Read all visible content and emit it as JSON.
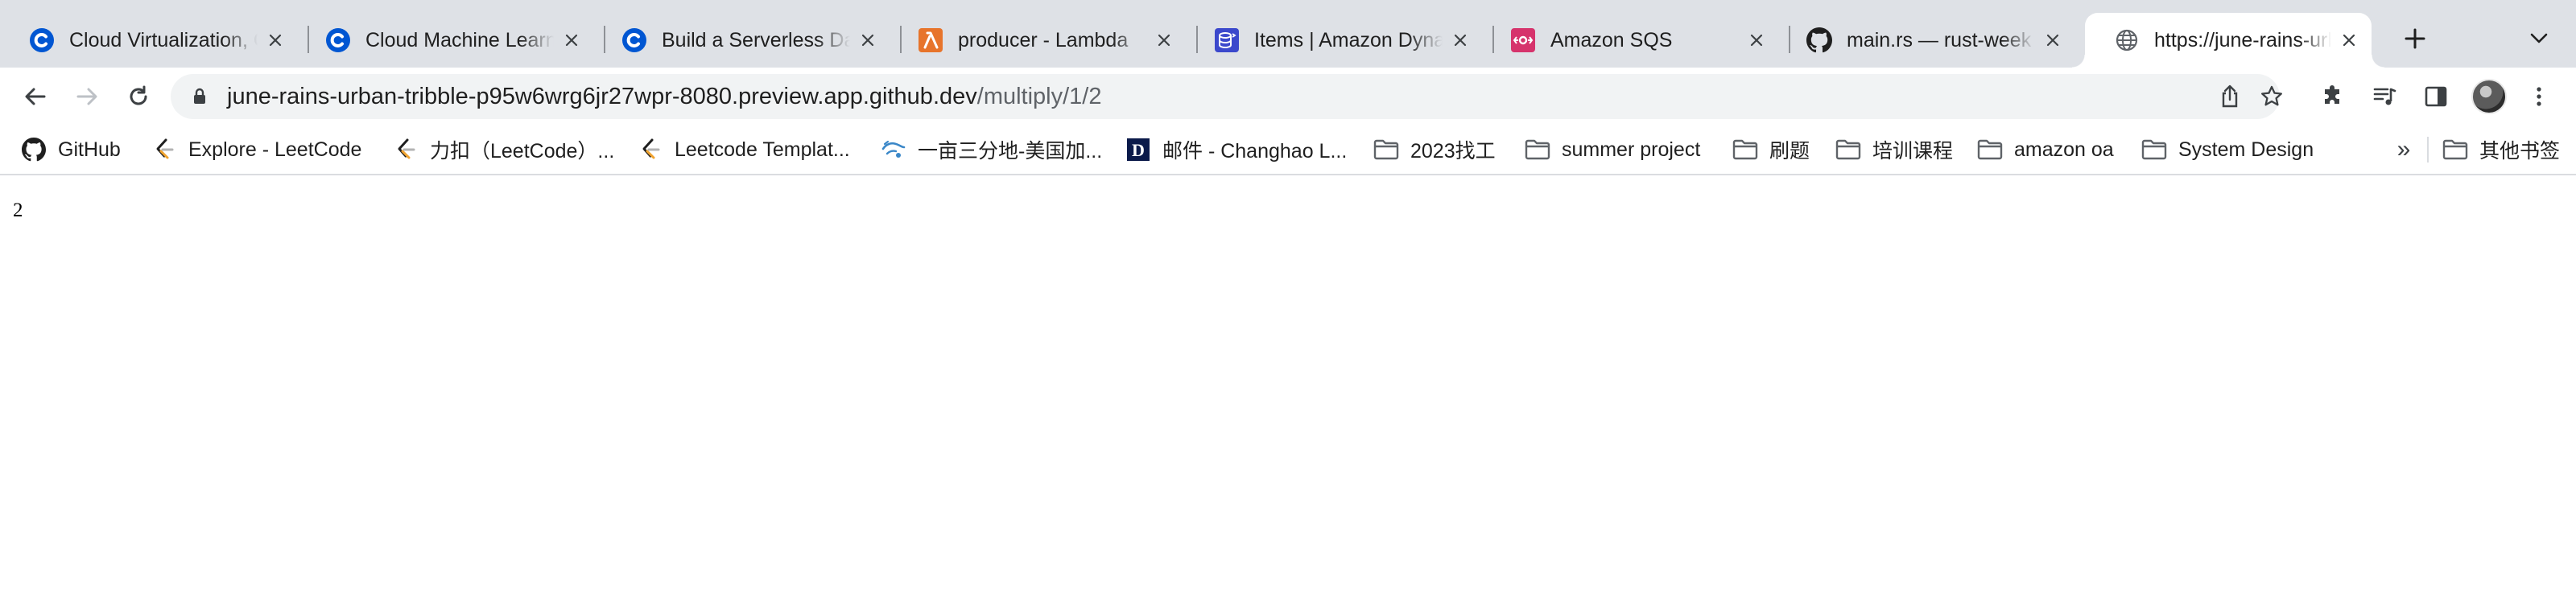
{
  "tabs": [
    {
      "title": "Cloud Virtualization, C",
      "icon": "coursera-icon",
      "active": false
    },
    {
      "title": "Cloud Machine Learni",
      "icon": "coursera-icon",
      "active": false
    },
    {
      "title": "Build a Serverless Da",
      "icon": "coursera-icon",
      "active": false
    },
    {
      "title": "producer - Lambda",
      "icon": "aws-lambda-icon",
      "active": false
    },
    {
      "title": "Items | Amazon Dyna",
      "icon": "aws-dynamodb-icon",
      "active": false
    },
    {
      "title": "Amazon SQS",
      "icon": "aws-sqs-icon",
      "active": false
    },
    {
      "title": "main.rs — rust-week",
      "icon": "github-icon",
      "active": false
    },
    {
      "title": "https://june-rains-urb",
      "icon": "globe-icon",
      "active": true
    }
  ],
  "address_bar": {
    "host": "june-rains-urban-tribble-p95w6wrg6jr27wpr-8080.preview.app.github.dev",
    "path": "/multiply/1/2"
  },
  "bookmarks": [
    {
      "label": "GitHub",
      "icon": "github-icon"
    },
    {
      "label": "Explore - LeetCode",
      "icon": "leetcode-icon"
    },
    {
      "label": "力扣（LeetCode）...",
      "icon": "leetcode-icon"
    },
    {
      "label": "Leetcode Templat...",
      "icon": "leetcode-icon"
    },
    {
      "label": "一亩三分地-美国加...",
      "icon": "1point3acres-icon"
    },
    {
      "label": "邮件 - Changhao L...",
      "icon": "duke-d-icon"
    },
    {
      "label": "2023找工",
      "icon": "folder-icon"
    },
    {
      "label": "summer project",
      "icon": "folder-icon"
    },
    {
      "label": "刷题",
      "icon": "folder-icon"
    },
    {
      "label": "培训课程",
      "icon": "folder-icon"
    },
    {
      "label": "amazon oa",
      "icon": "folder-icon"
    },
    {
      "label": "System Design",
      "icon": "folder-icon"
    }
  ],
  "bookmarks_overflow": "»",
  "other_bookmarks": {
    "label": "其他书签",
    "icon": "folder-icon"
  },
  "page": {
    "result": "2"
  },
  "colors": {
    "tabstrip_bg": "#dee1e6",
    "omnibox_bg": "#f1f3f4",
    "coursera_blue": "#0056d2",
    "lambda_orange": "#e7742b",
    "dynamodb_blue": "#3b48cc",
    "sqs_pink": "#d6336c"
  }
}
